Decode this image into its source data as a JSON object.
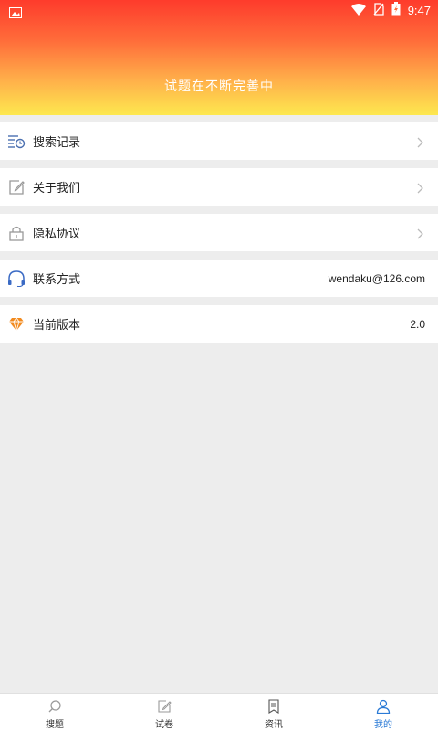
{
  "status": {
    "time": "9:47"
  },
  "header": {
    "title": "试题在不断完善中"
  },
  "menu": [
    {
      "label": "搜索记录",
      "icon": "search-history-icon",
      "value": ""
    },
    {
      "label": "关于我们",
      "icon": "edit-icon",
      "value": ""
    },
    {
      "label": "隐私协议",
      "icon": "lock-icon",
      "value": ""
    },
    {
      "label": "联系方式",
      "icon": "headset-icon",
      "value": "wendaku@126.com"
    },
    {
      "label": "当前版本",
      "icon": "diamond-icon",
      "value": "2.0"
    }
  ],
  "tabs": [
    {
      "label": "搜题",
      "icon": "search-icon"
    },
    {
      "label": "试卷",
      "icon": "edit-icon"
    },
    {
      "label": "资讯",
      "icon": "news-icon"
    },
    {
      "label": "我的",
      "icon": "user-icon",
      "active": true
    }
  ],
  "colors": {
    "accent": "#2a7ad6",
    "header_top": "#fe3b2c",
    "header_bottom": "#fde84f"
  }
}
